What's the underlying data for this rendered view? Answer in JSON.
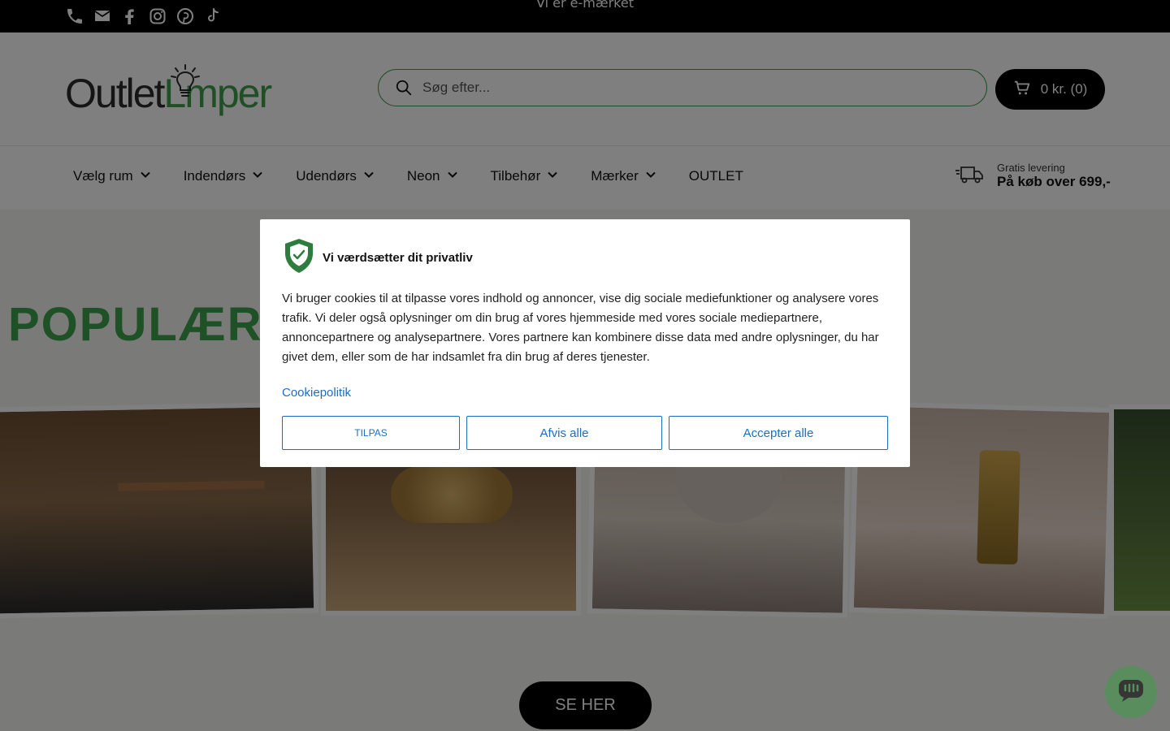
{
  "topbar": {
    "announcement": "Vi er e-mærket",
    "icons": [
      "phone-icon",
      "mail-icon",
      "facebook-icon",
      "instagram-icon",
      "pinterest-icon",
      "tiktok-icon"
    ]
  },
  "header": {
    "logo_part1": "Outlet",
    "logo_part2": "Lmper",
    "search_placeholder": "Søg efter...",
    "cart_label": "0 kr. (0)"
  },
  "nav": {
    "items": [
      {
        "label": "Vælg rum",
        "has_dropdown": true
      },
      {
        "label": "Indendørs",
        "has_dropdown": true
      },
      {
        "label": "Udendørs",
        "has_dropdown": true
      },
      {
        "label": "Neon",
        "has_dropdown": true
      },
      {
        "label": "Tilbehør",
        "has_dropdown": true
      },
      {
        "label": "Mærker",
        "has_dropdown": true
      },
      {
        "label": "OUTLET",
        "has_dropdown": false
      }
    ],
    "delivery_small": "Gratis levering",
    "delivery_big": "På køb over 699,-"
  },
  "hero": {
    "title": "POPULÆRE LAMPER TIL DIT E HJEM",
    "cta": "SE HER"
  },
  "cookie_modal": {
    "title": "Vi værdsætter dit privatliv",
    "body": "Vi bruger cookies til at tilpasse vores indhold og annoncer, vise dig sociale mediefunktioner og analysere vores trafik. Vi deler også oplysninger om din brug af vores hjemmeside med vores sociale mediepartnere, annoncepartnere og analysepartnere. Vores partnere kan kombinere disse data med andre oplysninger, du har givet dem, eller som de har indsamlet fra din brug af deres tjenester.",
    "policy_link": "Cookiepolitik",
    "btn_customize": "TILPAS",
    "btn_reject": "Afvis alle",
    "btn_accept": "Accepter alle"
  },
  "colors": {
    "brand_green": "#3f9e4a",
    "link_blue": "#1b6fc2",
    "black": "#000000"
  }
}
